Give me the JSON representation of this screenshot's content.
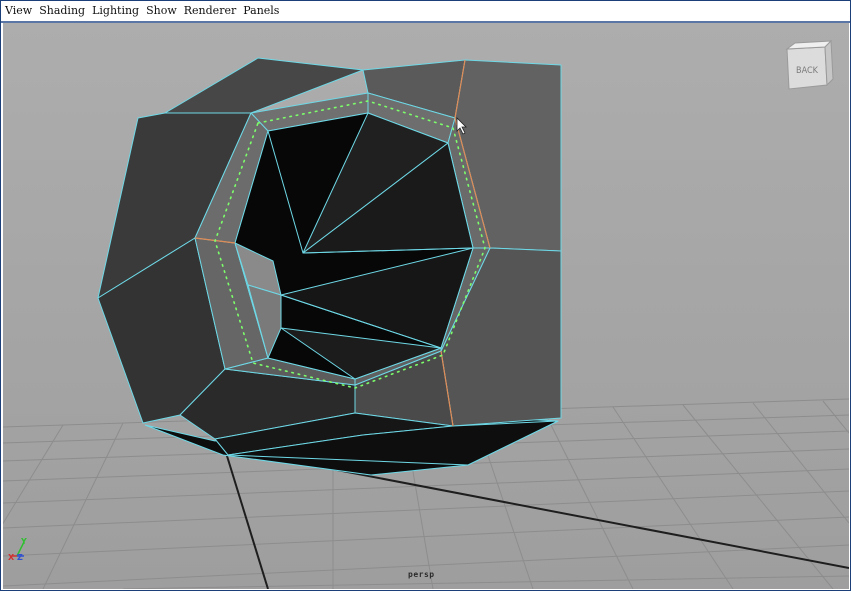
{
  "menu": [
    "View",
    "Shading",
    "Lighting",
    "Show",
    "Renderer",
    "Panels"
  ],
  "viewcube_label": "BACK",
  "camera_label": "persp",
  "axis": {
    "x": "X",
    "y": "Y",
    "z": "Z"
  },
  "colors": {
    "viewport_bg": "#a8a8a8",
    "wireframe": "#6ed8e6",
    "selection_dots": "#7cff6a",
    "grid": "#8c8c8c"
  }
}
